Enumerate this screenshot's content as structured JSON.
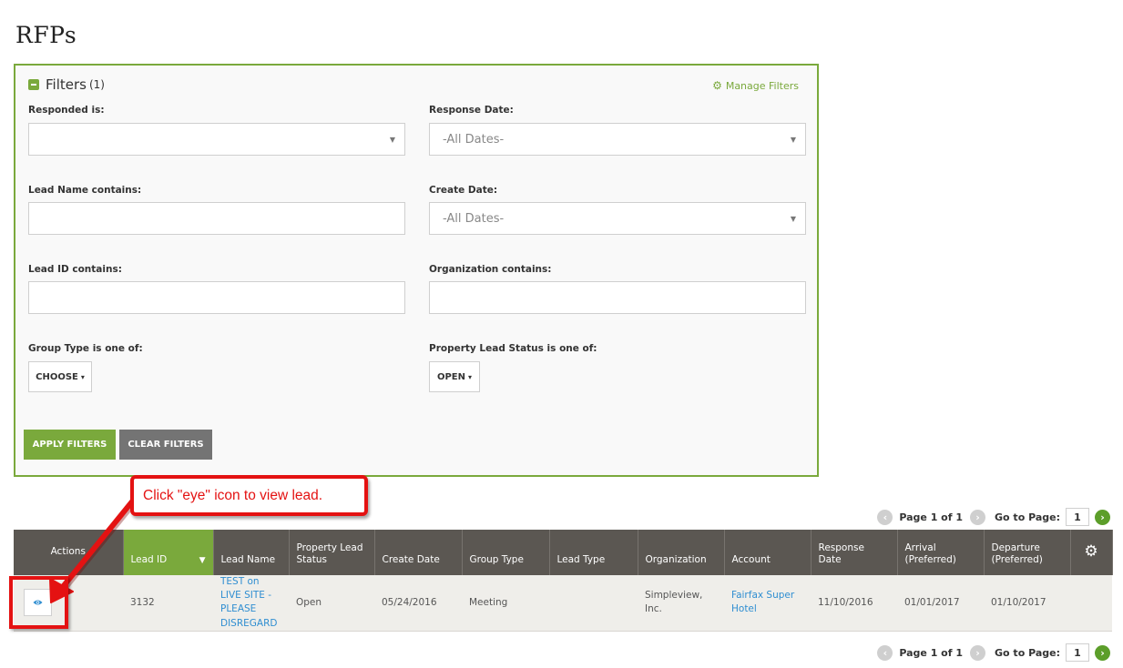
{
  "page": {
    "title": "RFPs"
  },
  "filters": {
    "header_label": "Filters",
    "count": "(1)",
    "manage_label": "Manage Filters",
    "fields": {
      "responded": {
        "label": "Responded is:",
        "value": ""
      },
      "response_date": {
        "label": "Response Date:",
        "value": "-All Dates-"
      },
      "lead_name": {
        "label": "Lead Name contains:",
        "value": ""
      },
      "create_date": {
        "label": "Create Date:",
        "value": "-All Dates-"
      },
      "lead_id": {
        "label": "Lead ID contains:",
        "value": ""
      },
      "organization": {
        "label": "Organization contains:",
        "value": ""
      },
      "group_type": {
        "label": "Group Type is one of:",
        "value": "CHOOSE"
      },
      "lead_status": {
        "label": "Property Lead Status is one of:",
        "value": "OPEN"
      }
    },
    "apply_label": "APPLY FILTERS",
    "clear_label": "CLEAR FILTERS"
  },
  "pager": {
    "text": "Page 1 of 1",
    "goto_label": "Go to Page:",
    "page_value": "1"
  },
  "table": {
    "columns": [
      "Actions",
      "Lead ID",
      "Lead Name",
      "Property Lead Status",
      "Create Date",
      "Group Type",
      "Lead Type",
      "Organization",
      "Account",
      "Response Date",
      "Arrival (Preferred)",
      "Departure (Preferred)"
    ],
    "sorted_column": "Lead ID",
    "rows": [
      {
        "lead_id": "3132",
        "lead_name": "TEST on LIVE SITE - PLEASE DISREGARD",
        "status": "Open",
        "create_date": "05/24/2016",
        "group_type": "Meeting",
        "lead_type": "",
        "organization": "Simpleview, Inc.",
        "account": "Fairfax Super Hotel",
        "response_date": "11/10/2016",
        "arrival": "01/01/2017",
        "departure": "01/10/2017"
      }
    ]
  },
  "annotation": {
    "callout_text": "Click \"eye\" icon to view lead.",
    "color": "#e41212"
  },
  "colors": {
    "accent_green": "#7aa93c",
    "header_dark": "#5b5752",
    "link_blue": "#2f8ed1"
  }
}
